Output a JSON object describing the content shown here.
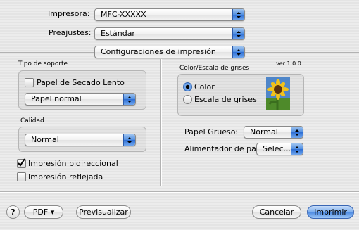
{
  "printer": {
    "label": "Impresora:",
    "value": "MFC-XXXXX"
  },
  "presets": {
    "label": "Preajustes:",
    "value": "Estándar"
  },
  "panel_select": {
    "value": "Configuraciones de impresión"
  },
  "media": {
    "title": "Tipo de soporte",
    "slow_dry_label": "Papel de Secado Lento",
    "slow_dry_checked": false,
    "paper_type": "Papel normal"
  },
  "color": {
    "title": "Color/Escala de grises",
    "version": "ver:1.0.0",
    "options": [
      "Color",
      "Escala de grises"
    ],
    "selected": "Color",
    "preview_icon": "sunflower-photo-icon"
  },
  "quality": {
    "title": "Calidad",
    "value": "Normal"
  },
  "thick_paper": {
    "label": "Papel Grueso:",
    "value": "Normal"
  },
  "paper_source": {
    "label": "Alimentador de papel:",
    "value": "Selec..."
  },
  "options": {
    "bidirectional_label": "Impresión bidireccional",
    "bidirectional_checked": true,
    "mirror_label": "Impresión reflejada",
    "mirror_checked": false
  },
  "footer": {
    "help_label": "?",
    "pdf_label": "PDF ▾",
    "preview_label": "Previsualizar",
    "cancel_label": "Cancelar",
    "print_label": "Imprimir"
  },
  "colors": {
    "accent": "#3f7fdc",
    "popup_arrow": "#4f8de0"
  }
}
